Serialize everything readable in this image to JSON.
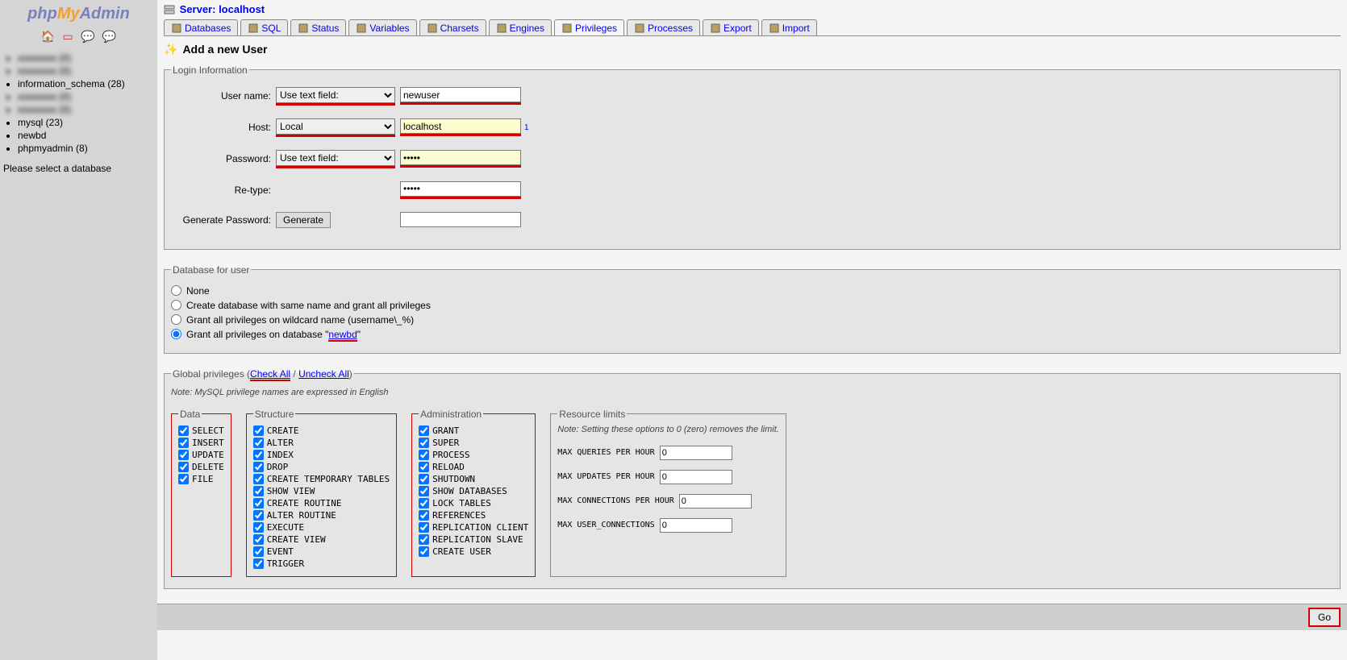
{
  "logo": {
    "php": "php",
    "my": "My",
    "admin": "Admin"
  },
  "sidebar": {
    "databases": [
      {
        "name": "",
        "blur": true
      },
      {
        "name": "",
        "blur": true
      },
      {
        "name": "information_schema (28)"
      },
      {
        "name": "",
        "blur": true
      },
      {
        "name": "",
        "blur": true
      },
      {
        "name": "mysql (23)"
      },
      {
        "name": "newbd"
      },
      {
        "name": "phpmyadmin (8)"
      }
    ],
    "select_label": "Please select a database"
  },
  "server": {
    "label": "Server:",
    "name": "localhost"
  },
  "tabs": [
    {
      "id": "databases",
      "label": "Databases"
    },
    {
      "id": "sql",
      "label": "SQL"
    },
    {
      "id": "status",
      "label": "Status"
    },
    {
      "id": "variables",
      "label": "Variables"
    },
    {
      "id": "charsets",
      "label": "Charsets"
    },
    {
      "id": "engines",
      "label": "Engines"
    },
    {
      "id": "privileges",
      "label": "Privileges",
      "active": true
    },
    {
      "id": "processes",
      "label": "Processes"
    },
    {
      "id": "export",
      "label": "Export"
    },
    {
      "id": "import",
      "label": "Import"
    }
  ],
  "page_title": "Add a new User",
  "login": {
    "legend": "Login Information",
    "username_label": "User name:",
    "username_sel": "Use text field:",
    "username_val": "newuser",
    "host_label": "Host:",
    "host_sel": "Local",
    "host_val": "localhost",
    "host_note": "1",
    "password_label": "Password:",
    "password_sel": "Use text field:",
    "password_val": "•••••",
    "retype_label": "Re-type:",
    "retype_val": "•••••",
    "gen_label": "Generate Password:",
    "gen_btn": "Generate"
  },
  "dbuser": {
    "legend": "Database for user",
    "opts": [
      "None",
      "Create database with same name and grant all privileges",
      "Grant all privileges on wildcard name (username\\_%)"
    ],
    "opt_grant_prefix": "Grant all privileges on database \"",
    "opt_grant_db": "newbd",
    "opt_grant_suffix": "\""
  },
  "global": {
    "legend_prefix": "Global privileges (",
    "check_all": "Check All",
    "sep": " / ",
    "uncheck_all": "Uncheck All",
    "legend_suffix": ")",
    "note": "Note: MySQL privilege names are expressed in English",
    "data_legend": "Data",
    "structure_legend": "Structure",
    "admin_legend": "Administration",
    "resource_legend": "Resource limits",
    "resource_note": "Note: Setting these options to 0 (zero) removes the limit.",
    "data_privs": [
      "SELECT",
      "INSERT",
      "UPDATE",
      "DELETE",
      "FILE"
    ],
    "structure_privs": [
      "CREATE",
      "ALTER",
      "INDEX",
      "DROP",
      "CREATE TEMPORARY TABLES",
      "SHOW VIEW",
      "CREATE ROUTINE",
      "ALTER ROUTINE",
      "EXECUTE",
      "CREATE VIEW",
      "EVENT",
      "TRIGGER"
    ],
    "admin_privs": [
      "GRANT",
      "SUPER",
      "PROCESS",
      "RELOAD",
      "SHUTDOWN",
      "SHOW DATABASES",
      "LOCK TABLES",
      "REFERENCES",
      "REPLICATION CLIENT",
      "REPLICATION SLAVE",
      "CREATE USER"
    ],
    "resource_limits": [
      {
        "label": "MAX QUERIES PER HOUR",
        "val": "0"
      },
      {
        "label": "MAX UPDATES PER HOUR",
        "val": "0"
      },
      {
        "label": "MAX CONNECTIONS PER HOUR",
        "val": "0"
      },
      {
        "label": "MAX USER_CONNECTIONS",
        "val": "0"
      }
    ]
  },
  "go": "Go"
}
